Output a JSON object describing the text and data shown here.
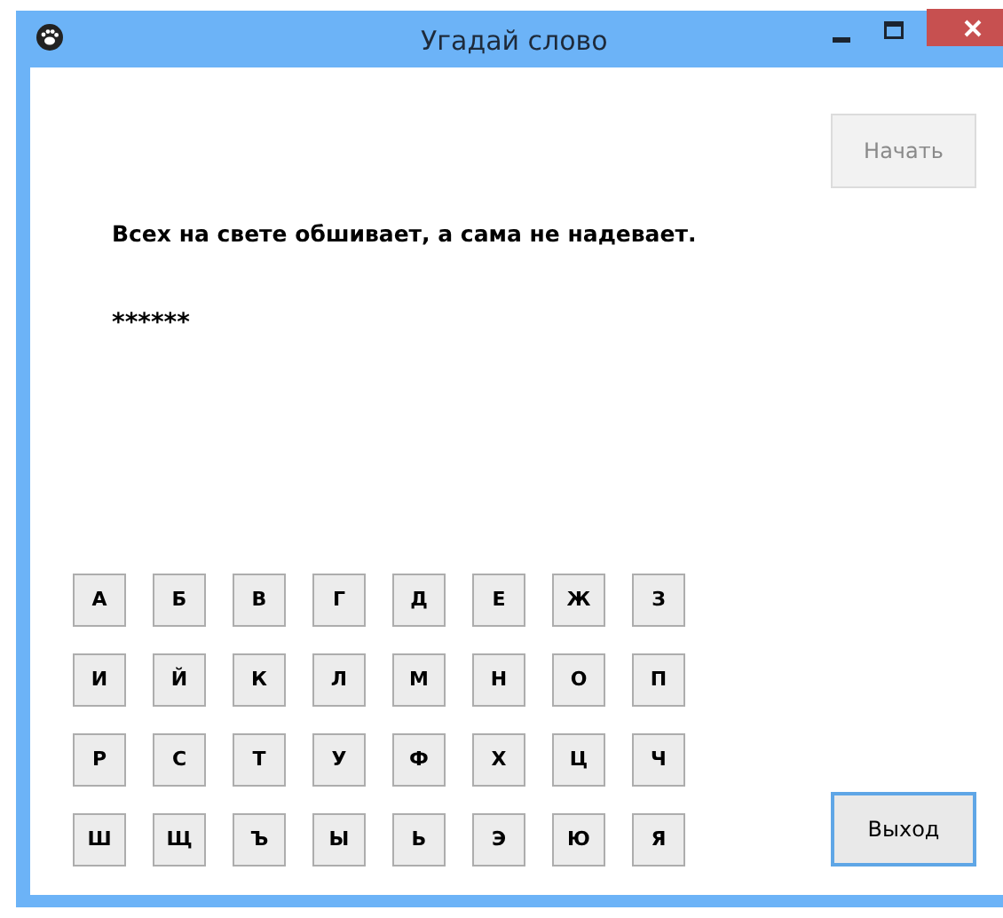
{
  "window": {
    "title": "Угадай слово"
  },
  "start_button": {
    "label": "Начать",
    "disabled": true
  },
  "riddle": "Всех на свете обшивает, а сама не надевает.",
  "masked_word": "******",
  "letters": [
    "А",
    "Б",
    "В",
    "Г",
    "Д",
    "Е",
    "Ж",
    "З",
    "И",
    "Й",
    "К",
    "Л",
    "М",
    "Н",
    "О",
    "П",
    "Р",
    "С",
    "Т",
    "У",
    "Ф",
    "Х",
    "Ц",
    "Ч",
    "Ш",
    "Щ",
    "Ъ",
    "Ы",
    "Ь",
    "Э",
    "Ю",
    "Я"
  ],
  "exit_button": {
    "label": "Выход",
    "focused": true
  }
}
